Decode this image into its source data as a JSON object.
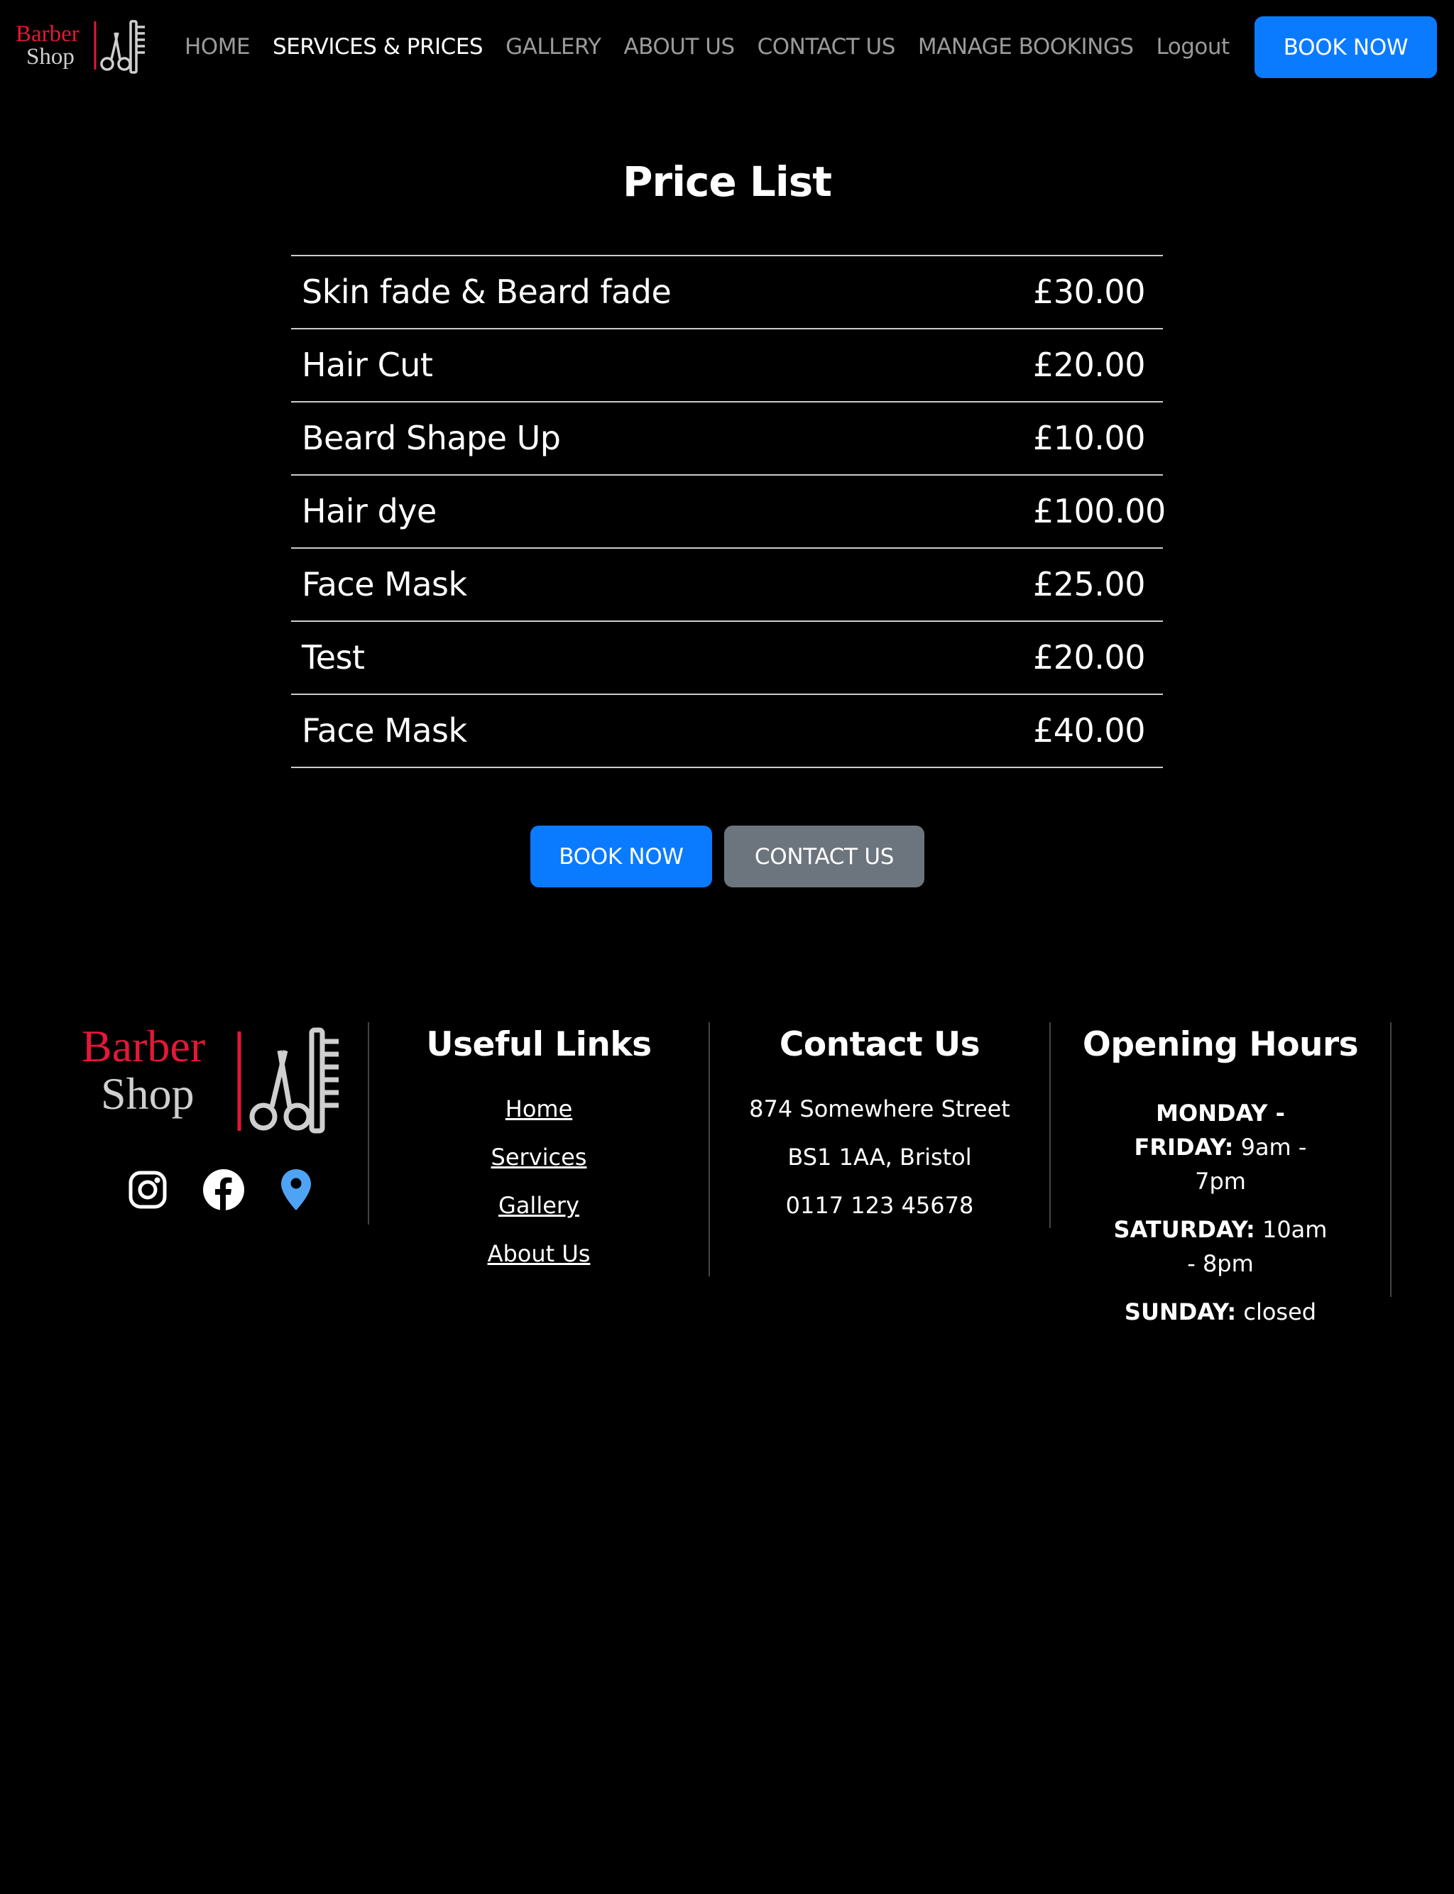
{
  "brand": {
    "word1": "Barber",
    "word2": "Shop",
    "accent_color": "#e31837",
    "icon": "scissors-comb-icon"
  },
  "nav": {
    "items": [
      {
        "label": "HOME",
        "active": false
      },
      {
        "label": "SERVICES & PRICES",
        "active": true
      },
      {
        "label": "GALLERY",
        "active": false
      },
      {
        "label": "ABOUT US",
        "active": false
      },
      {
        "label": "CONTACT US",
        "active": false
      },
      {
        "label": "MANAGE BOOKINGS",
        "active": false
      },
      {
        "label": "Logout",
        "active": false
      }
    ],
    "book_label": "BOOK NOW"
  },
  "price_list": {
    "title": "Price List",
    "items": [
      {
        "name": "Skin fade & Beard fade",
        "price": "£30.00"
      },
      {
        "name": "Hair Cut",
        "price": "£20.00"
      },
      {
        "name": "Beard Shape Up",
        "price": "£10.00"
      },
      {
        "name": "Hair dye",
        "price": "£100.00"
      },
      {
        "name": "Face Mask",
        "price": "£25.00"
      },
      {
        "name": "Test",
        "price": "£20.00"
      },
      {
        "name": "Face Mask",
        "price": "£40.00"
      }
    ]
  },
  "cta": {
    "book_label": "BOOK NOW",
    "contact_label": "CONTACT US"
  },
  "footer": {
    "social_icons": [
      "instagram-icon",
      "facebook-icon",
      "map-pin-icon"
    ],
    "links": {
      "heading": "Useful Links",
      "items": [
        "Home",
        "Services",
        "Gallery",
        "About Us"
      ]
    },
    "contact": {
      "heading": "Contact Us",
      "address_line1": "874 Somewhere Street",
      "address_line2": "BS1 1AA, Bristol",
      "phone": "0117 123 45678"
    },
    "hours": {
      "heading": "Opening Hours",
      "weekday_label": "MONDAY - FRIDAY:",
      "weekday_hours": "9am - 7pm",
      "saturday_label": "SATURDAY:",
      "saturday_hours": "10am - 8pm",
      "sunday_label": "SUNDAY:",
      "sunday_hours": "closed"
    }
  },
  "colors": {
    "background": "#000000",
    "primary": "#0a7bff",
    "secondary": "#6c757d",
    "map_pin": "#4ea3f5"
  }
}
